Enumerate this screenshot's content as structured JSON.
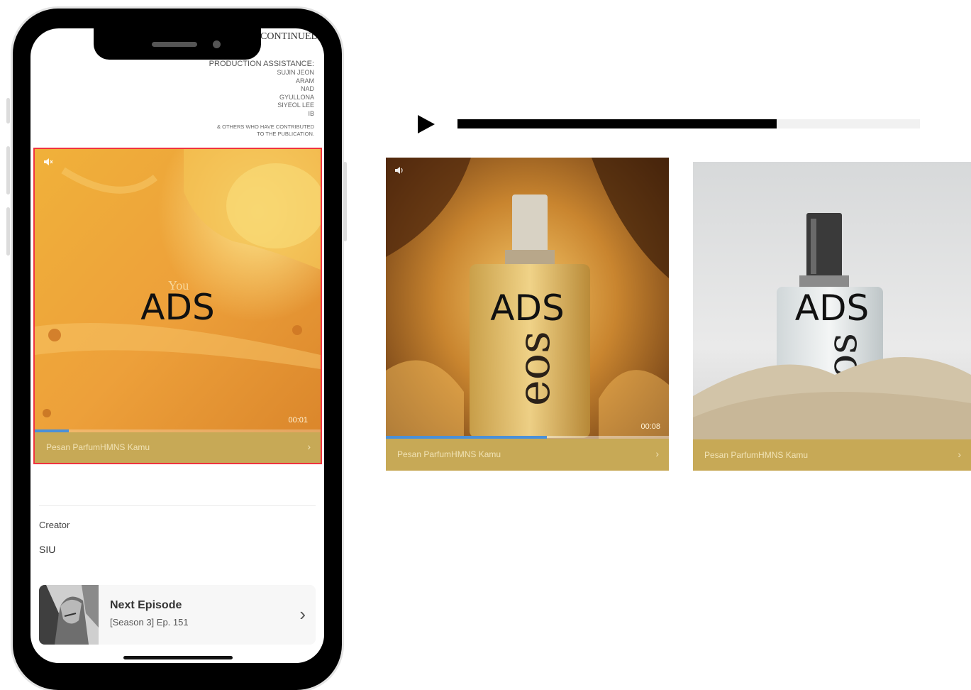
{
  "phone": {
    "continued_text": "CONTINUED",
    "credits": {
      "heading": "PRODUCTION ASSISTANCE:",
      "names": [
        "SUJIN JEON",
        "ARAM",
        "NAD",
        "GYULLONA",
        "SIYEOL LEE",
        "IB"
      ],
      "ack_line1": "& OTHERS WHO HAVE CONTRIBUTED",
      "ack_line2": "TO THE PUBLICATION."
    },
    "ad": {
      "label": "ADS",
      "overlay_word": "You",
      "timer": "00:01",
      "progress": 0.12,
      "cta": "Pesan ParfumHMNS Kamu",
      "chevron": "›",
      "icon": "volume-icon"
    },
    "creator_label": "Creator",
    "creator_name": "SIU",
    "next_episode": {
      "title": "Next Episode",
      "subtitle": "[Season 3] Ep. 151",
      "chevron": "›"
    }
  },
  "player": {
    "icon": "play-icon",
    "progress": 0.69
  },
  "ads": [
    {
      "label": "ADS",
      "timer": "00:08",
      "progress": 0.57,
      "cta": "Pesan ParfumHMNS Kamu",
      "chevron": "›"
    },
    {
      "label": "ADS",
      "cta": "Pesan ParfumHMNS Kamu",
      "chevron": "›"
    }
  ],
  "colors": {
    "highlight_border": "#f0333f",
    "cta_bar": "#c7a956",
    "progress": "#4a90d9"
  }
}
